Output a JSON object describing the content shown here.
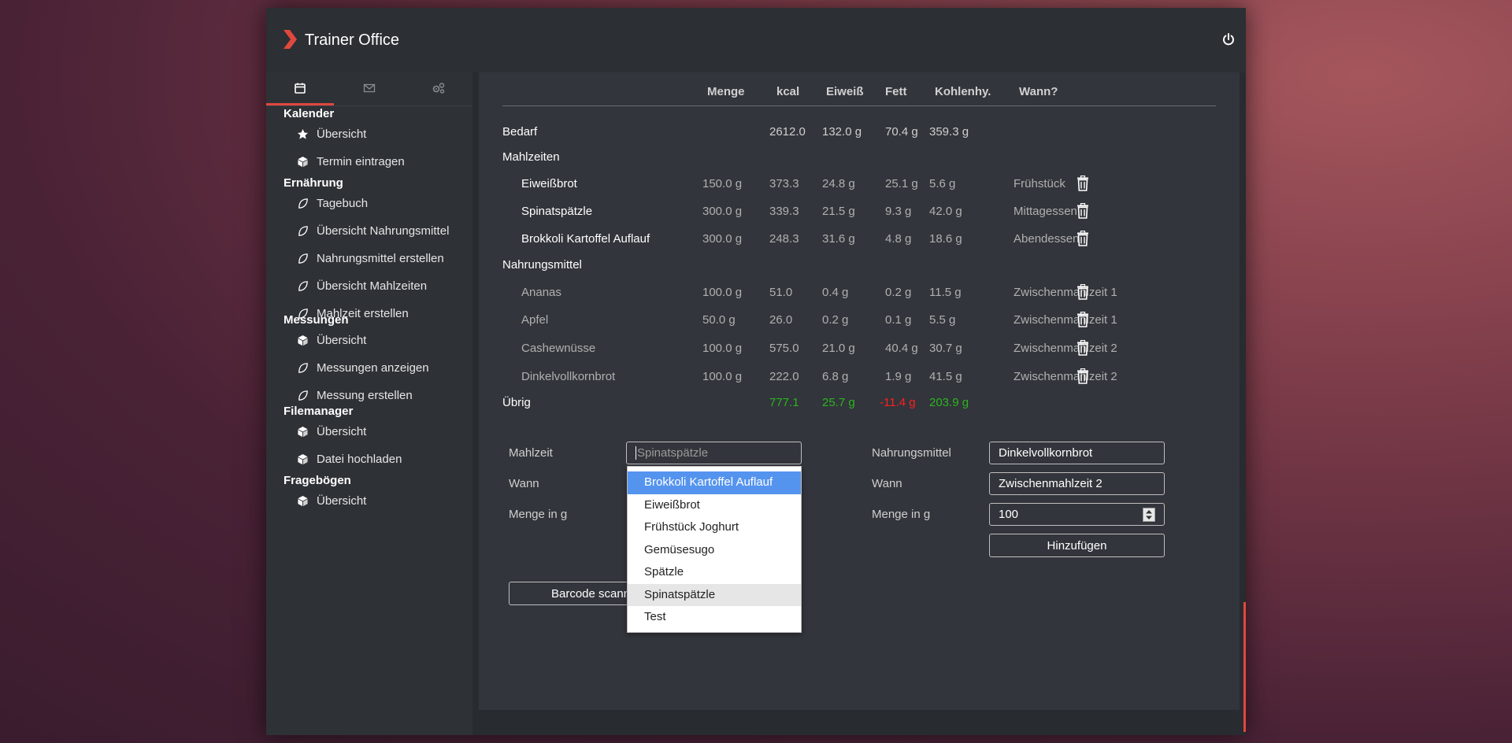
{
  "app": {
    "title": "Trainer Office"
  },
  "sidebar": {
    "tabs": [
      {
        "icon": "calendar-icon",
        "active": true
      },
      {
        "icon": "envelope-icon",
        "active": false
      },
      {
        "icon": "cogs-icon",
        "active": false
      }
    ],
    "sections": [
      {
        "title": "Kalender",
        "items": [
          {
            "label": "Übersicht",
            "icon": "star-icon"
          },
          {
            "label": "Termin eintragen",
            "icon": "cube-icon"
          }
        ]
      },
      {
        "title": "Ernährung",
        "items": [
          {
            "label": "Tagebuch",
            "icon": "leaf-icon"
          },
          {
            "label": "Übersicht Nahrungsmittel",
            "icon": "leaf-icon"
          },
          {
            "label": "Nahrungsmittel erstellen",
            "icon": "leaf-icon"
          },
          {
            "label": "Übersicht Mahlzeiten",
            "icon": "leaf-icon"
          },
          {
            "label": "Mahlzeit erstellen",
            "icon": "leaf-icon"
          }
        ]
      },
      {
        "title": "Messungen",
        "items": [
          {
            "label": "Übersicht",
            "icon": "cube-icon"
          },
          {
            "label": "Messungen anzeigen",
            "icon": "leaf-icon"
          },
          {
            "label": "Messung erstellen",
            "icon": "leaf-icon"
          }
        ]
      },
      {
        "title": "Filemanager",
        "items": [
          {
            "label": "Übersicht",
            "icon": "cube-icon"
          },
          {
            "label": "Datei hochladen",
            "icon": "cube-icon"
          }
        ]
      },
      {
        "title": "Fragebögen",
        "items": [
          {
            "label": "Übersicht",
            "icon": "cube-icon"
          }
        ]
      }
    ]
  },
  "table": {
    "headers": [
      "Menge",
      "kcal",
      "Eiweiß",
      "Fett",
      "Kohlenhy.",
      "Wann?"
    ],
    "bedarf": {
      "label": "Bedarf",
      "kcal": "2612.0",
      "eiweiss": "132.0 g",
      "fett": "70.4 g",
      "kohlenhy": "359.3 g"
    },
    "mahlzeiten_label": "Mahlzeiten",
    "mahlzeiten": [
      {
        "name": "Eiweißbrot",
        "menge": "150.0 g",
        "kcal": "373.3",
        "eiweiss": "24.8 g",
        "fett": "25.1 g",
        "kohlenhy": "5.6 g",
        "wann": "Frühstück"
      },
      {
        "name": "Spinatspätzle",
        "menge": "300.0 g",
        "kcal": "339.3",
        "eiweiss": "21.5 g",
        "fett": "9.3 g",
        "kohlenhy": "42.0 g",
        "wann": "Mittagessen"
      },
      {
        "name": "Brokkoli Kartoffel Auflauf",
        "menge": "300.0 g",
        "kcal": "248.3",
        "eiweiss": "31.6 g",
        "fett": "4.8 g",
        "kohlenhy": "18.6 g",
        "wann": "Abendessen"
      }
    ],
    "nahrungsmittel_label": "Nahrungsmittel",
    "nahrungsmittel": [
      {
        "name": "Ananas",
        "menge": "100.0 g",
        "kcal": "51.0",
        "eiweiss": "0.4 g",
        "fett": "0.2 g",
        "kohlenhy": "11.5 g",
        "wann": "Zwischenmahlzeit 1"
      },
      {
        "name": "Apfel",
        "menge": "50.0 g",
        "kcal": "26.0",
        "eiweiss": "0.2 g",
        "fett": "0.1 g",
        "kohlenhy": "5.5 g",
        "wann": "Zwischenmahlzeit 1"
      },
      {
        "name": "Cashewnüsse",
        "menge": "100.0 g",
        "kcal": "575.0",
        "eiweiss": "21.0 g",
        "fett": "40.4 g",
        "kohlenhy": "30.7 g",
        "wann": "Zwischenmahlzeit 2"
      },
      {
        "name": "Dinkelvollkornbrot",
        "menge": "100.0 g",
        "kcal": "222.0",
        "eiweiss": "6.8 g",
        "fett": "1.9 g",
        "kohlenhy": "41.5 g",
        "wann": "Zwischenmahlzeit 2"
      }
    ],
    "uebrig": {
      "label": "Übrig",
      "kcal": "777.1",
      "eiweiss": "25.7 g",
      "fett": "-11.4 g",
      "kohlenhy": "203.9 g"
    }
  },
  "form_left": {
    "mahlzeit_label": "Mahlzeit",
    "mahlzeit_placeholder": "Spinatspätzle",
    "wann_label": "Wann",
    "menge_label": "Menge in g",
    "barcode_button": "Barcode scann"
  },
  "dropdown": {
    "options": [
      "Brokkoli Kartoffel Auflauf",
      "Eiweißbrot",
      "Frühstück Joghurt",
      "Gemüsesugo",
      "Spätzle",
      "Spinatspätzle",
      "Test"
    ],
    "highlighted": "Brokkoli Kartoffel Auflauf",
    "selected": "Spinatspätzle"
  },
  "form_right": {
    "nahrungsmittel_label": "Nahrungsmittel",
    "nahrungsmittel_value": "Dinkelvollkornbrot",
    "wann_label": "Wann",
    "wann_value": "Zwischenmahlzeit 2",
    "menge_label": "Menge in g",
    "menge_value": "100",
    "add_button": "Hinzufügen"
  },
  "colors": {
    "accent": "#e0483e",
    "positive": "#2bb51f",
    "negative": "#ff1f1f",
    "highlight": "#5594ee"
  }
}
